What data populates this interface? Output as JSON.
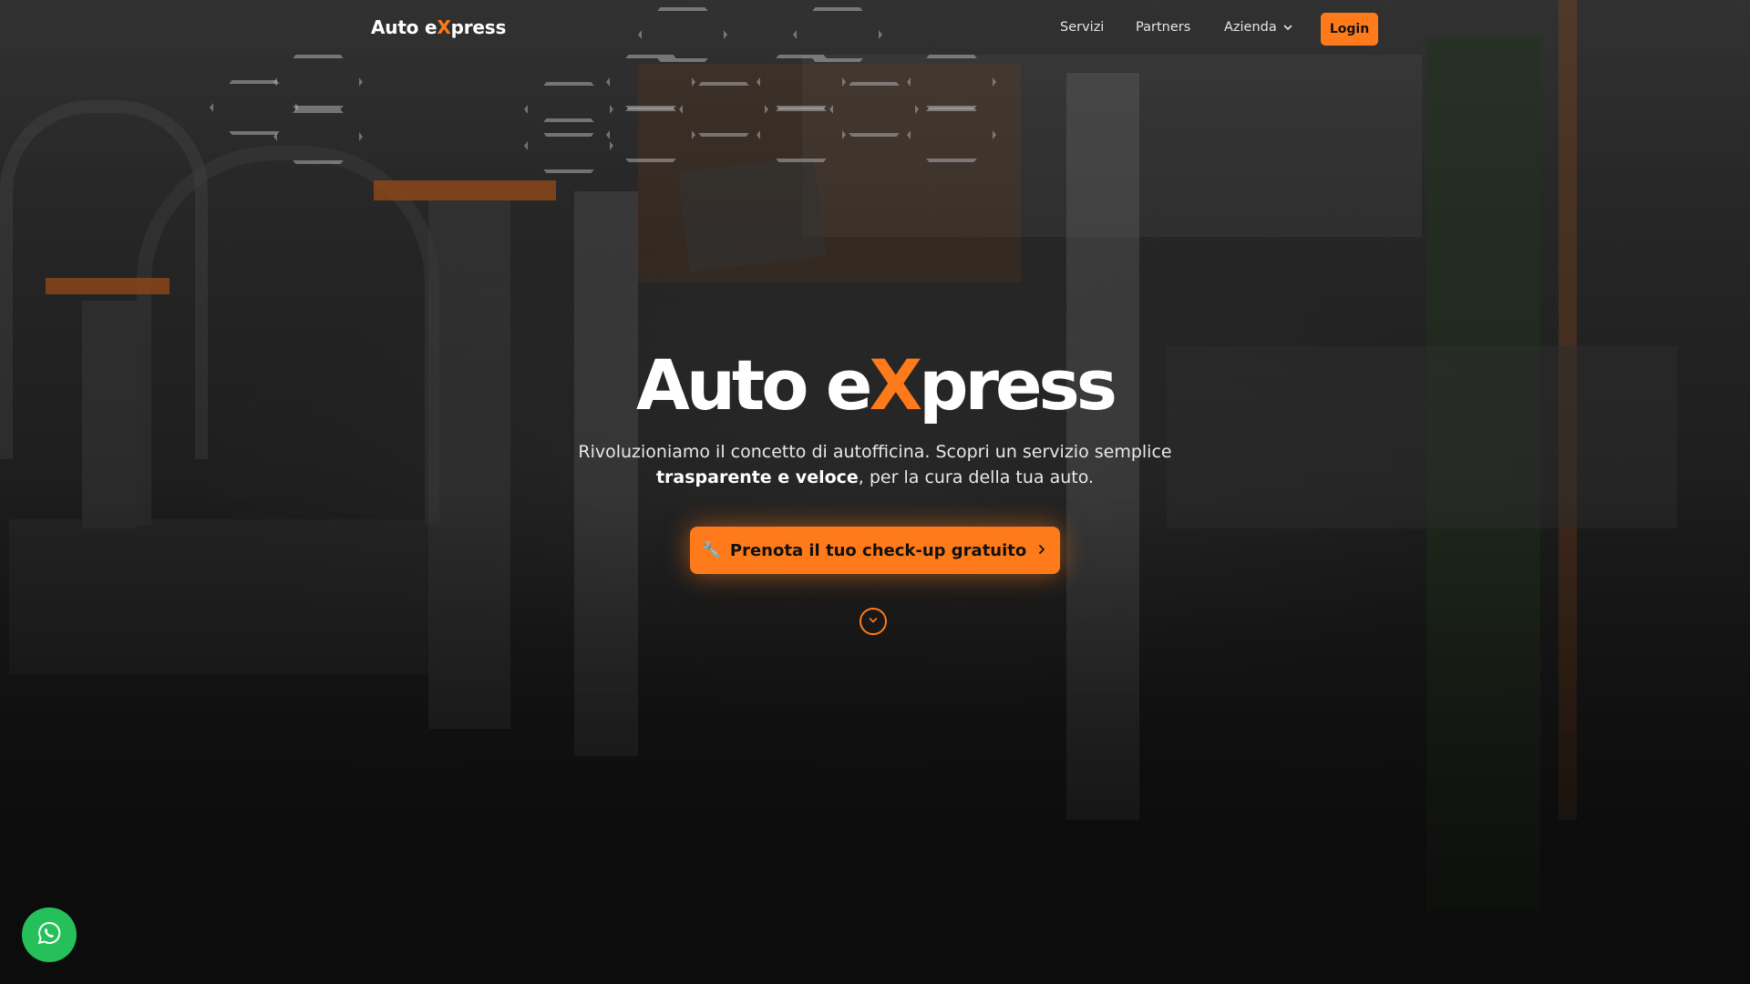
{
  "navbar": {
    "brand_prefix": "Auto e",
    "brand_x": "X",
    "brand_suffix": "press",
    "links": [
      {
        "label": "Servizi"
      },
      {
        "label": "Partners"
      },
      {
        "label": "Azienda"
      }
    ],
    "login_label": "Login"
  },
  "hero": {
    "title_prefix": "Auto e",
    "title_x": "X",
    "title_suffix": "press",
    "subtitle_line1": "Rivoluzioniamo il concetto di autofficina. Scopri un servizio semplice",
    "subtitle_bold": "trasparente e veloce",
    "subtitle_line2_rest": ", per la cura della tua auto.",
    "cta_icon": "🔧",
    "cta_label": "Prenota il tuo check-up gratuito"
  },
  "icons": {
    "dropdown": "chevron-down-icon",
    "cta_arrow": "chevron-right-icon",
    "scroll": "chevron-down-circle-icon",
    "chat": "whatsapp-icon"
  },
  "colors": {
    "accent": "#ff7a1a",
    "whatsapp": "#25c05a",
    "background": "#1e1e1e"
  }
}
